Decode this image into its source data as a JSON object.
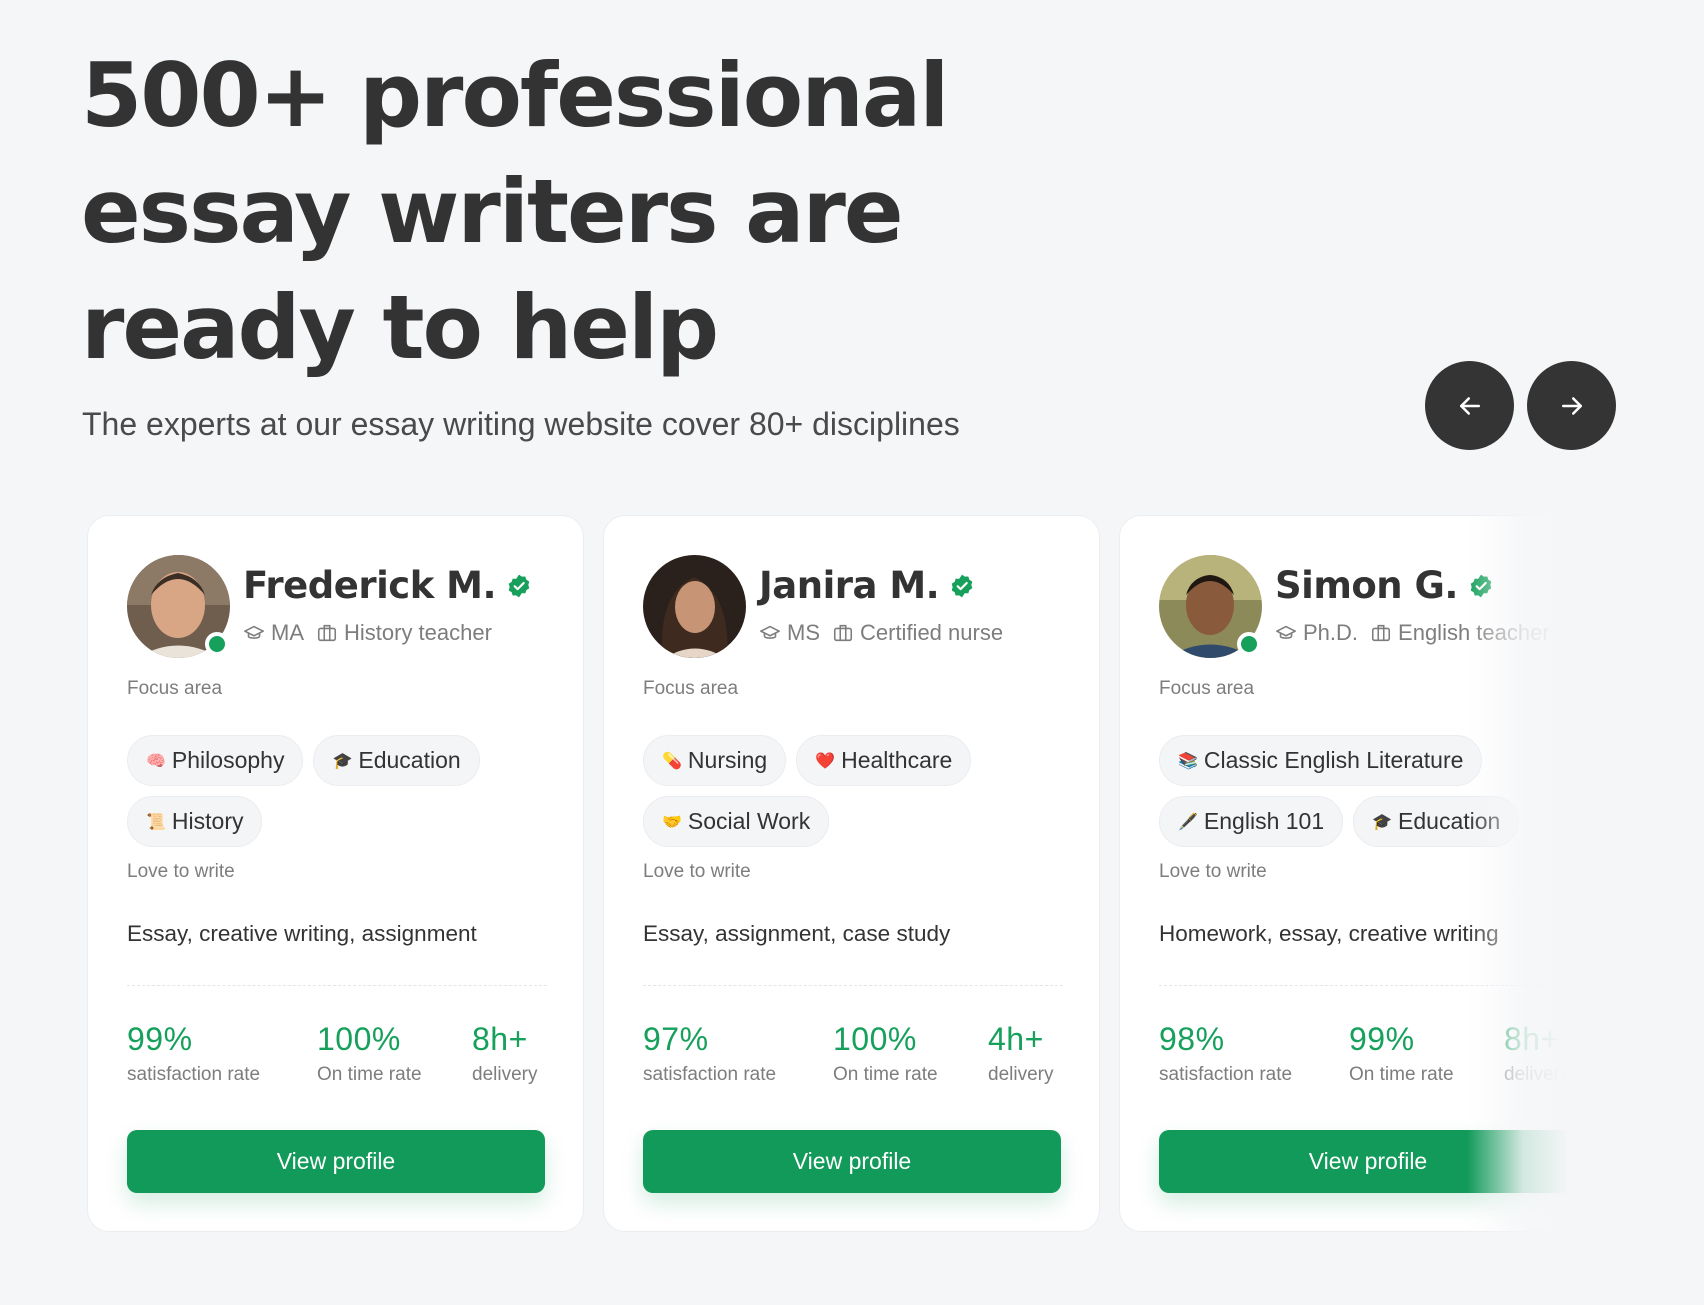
{
  "header": {
    "title": "500+ professional essay writers are ready to help",
    "subtitle": "The experts at our essay writing website cover 80+ disciplines"
  },
  "nav": {
    "prev_icon": "arrow-left-icon",
    "next_icon": "arrow-right-icon"
  },
  "labels": {
    "focus_area": "Focus area",
    "love_to_write": "Love to write",
    "satisfaction": "satisfaction rate",
    "on_time": "On time rate",
    "delivery": "delivery",
    "view_profile": "View profile"
  },
  "colors": {
    "accent": "#129a5a",
    "stat_green": "#16a05b",
    "dark": "#343434"
  },
  "writers": [
    {
      "name": "Frederick M.",
      "degree": "MA",
      "role": "History teacher",
      "verified_icon": "verified-badge-icon",
      "focus": [
        {
          "emoji": "🧠",
          "label": "Philosophy"
        },
        {
          "emoji": "🎓",
          "label": "Education"
        },
        {
          "emoji": "📜",
          "label": "History"
        }
      ],
      "love": "Essay, creative writing, assignment",
      "satisfaction": "99%",
      "on_time": "100%",
      "delivery": "8h+"
    },
    {
      "name": "Janira M.",
      "degree": "MS",
      "role": "Certified nurse",
      "verified_icon": "verified-badge-icon",
      "focus": [
        {
          "emoji": "💊",
          "label": "Nursing"
        },
        {
          "emoji": "❤️",
          "label": "Healthcare"
        },
        {
          "emoji": "🤝",
          "label": "Social Work"
        }
      ],
      "love": "Essay, assignment, case study",
      "satisfaction": "97%",
      "on_time": "100%",
      "delivery": "4h+"
    },
    {
      "name": "Simon G.",
      "degree": "Ph.D.",
      "role": "English teacher",
      "verified_icon": "verified-badge-icon",
      "focus": [
        {
          "emoji": "📚",
          "label": "Classic English Literature"
        },
        {
          "emoji": "🖋️",
          "label": "English 101"
        },
        {
          "emoji": "🎓",
          "label": "Education"
        }
      ],
      "love": "Homework, essay, creative writing",
      "satisfaction": "98%",
      "on_time": "99%",
      "delivery": "8h+"
    }
  ]
}
